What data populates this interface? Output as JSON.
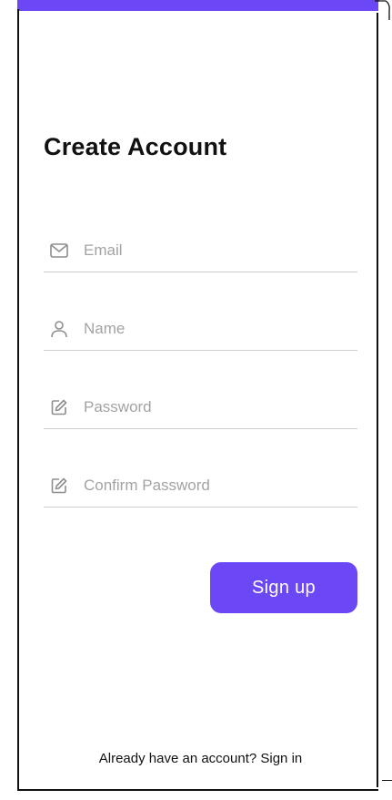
{
  "form": {
    "title": "Create Account",
    "fields": [
      {
        "placeholder": "Email",
        "value": "",
        "icon": "mail-icon"
      },
      {
        "placeholder": "Name",
        "value": "",
        "icon": "user-icon"
      },
      {
        "placeholder": "Password",
        "value": "",
        "icon": "edit-icon"
      },
      {
        "placeholder": "Confirm Password",
        "value": "",
        "icon": "edit-icon"
      }
    ],
    "submit_label": "Sign up"
  },
  "footer": {
    "prompt": "Already have an account? ",
    "signin_label": "Sign in"
  },
  "colors": {
    "accent": "#6c47f5",
    "text": "#111111",
    "placeholder": "#a3a3a3",
    "divider": "#cfcfcf"
  }
}
